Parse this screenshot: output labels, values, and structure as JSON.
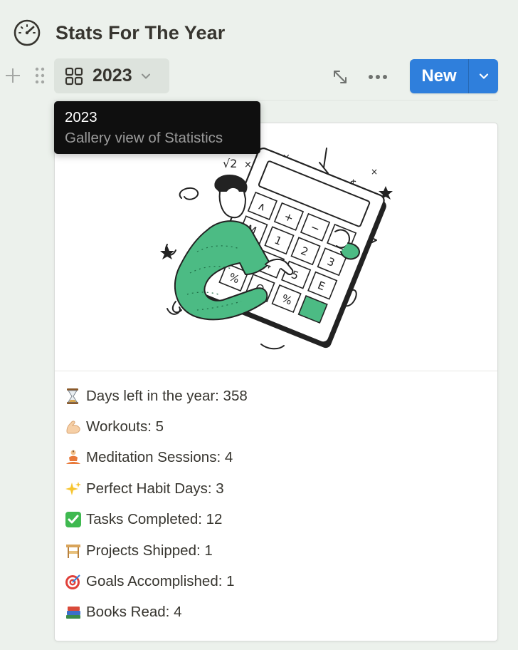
{
  "page": {
    "title": "Stats For The Year",
    "title_icon": "gauge-icon"
  },
  "toolbar": {
    "view_label": "2023",
    "view_icon": "gallery-grid-icon",
    "new_label": "New"
  },
  "tooltip": {
    "title": "2023",
    "subtitle": "Gallery view of Statistics"
  },
  "card": {
    "cover": "calculator-illustration",
    "stats": [
      {
        "emoji": "hourglass-icon",
        "text": "Days left in the year: 358"
      },
      {
        "emoji": "flexed-biceps-icon",
        "text": "Workouts: 5"
      },
      {
        "emoji": "person-meditating-icon",
        "text": "Meditation Sessions: 4"
      },
      {
        "emoji": "sparkles-icon",
        "text": "Perfect Habit Days: 3"
      },
      {
        "emoji": "check-mark-button-icon",
        "text": "Tasks Completed: 12"
      },
      {
        "emoji": "construction-icon",
        "text": "Projects Shipped: 1"
      },
      {
        "emoji": "direct-hit-icon",
        "text": "Goals Accomplished: 1"
      },
      {
        "emoji": "books-icon",
        "text": "Books Read: 4"
      }
    ]
  },
  "colors": {
    "accent": "#2f7fdc",
    "background": "#ecf1ec",
    "illustration_green": "#4cbb84"
  }
}
